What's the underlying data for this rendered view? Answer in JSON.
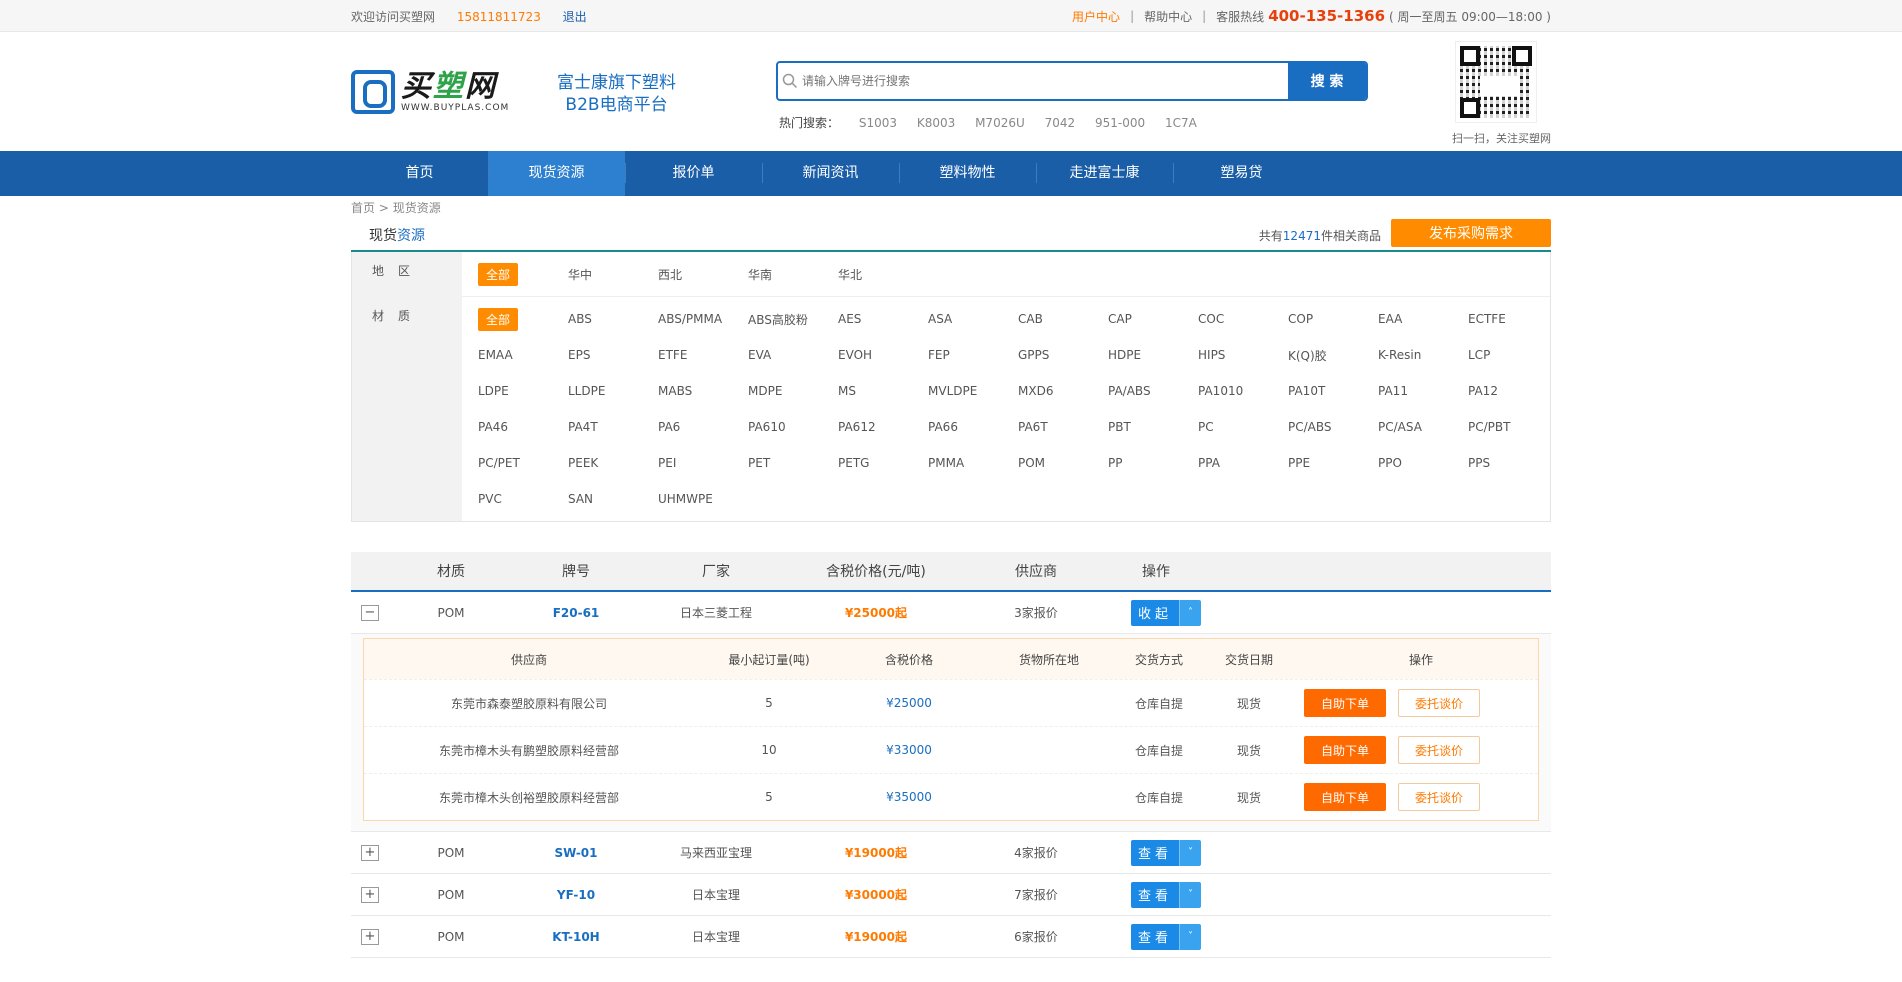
{
  "topbar": {
    "welcome": "欢迎访问买塑网",
    "phone": "15811811723",
    "logout": "退出",
    "user_center": "用户中心",
    "sep": "|",
    "help": "帮助中心",
    "hotline_label": "客服热线",
    "hotline": "400-135-1366",
    "hours": "( 周一至周五 09:00—18:00 )"
  },
  "header": {
    "logo_cn_a": "买",
    "logo_cn_b": "塑",
    "logo_cn_c": "网",
    "logo_en": "WWW.BUYPLAS.COM",
    "slogan_1": "富士康旗下塑料",
    "slogan_2": "B2B电商平台",
    "search_placeholder": "请输入牌号进行搜索",
    "search_button": "搜 索",
    "hot_label": "热门搜索：",
    "hot_words": [
      "S1003",
      "K8003",
      "M7026U",
      "7042",
      "951-000",
      "1C7A"
    ],
    "qr_caption": "扫一扫，关注买塑网"
  },
  "nav": {
    "items": [
      "首页",
      "现货资源",
      "报价单",
      "新闻资讯",
      "塑料物性",
      "走进富士康",
      "塑易贷"
    ]
  },
  "breadcrumb": {
    "home": "首页",
    "sep": ">",
    "current": "现货资源"
  },
  "section": {
    "title_a": "现货",
    "title_b": "资源",
    "count_pre": "共有",
    "count": "12471",
    "count_post": "件相关商品",
    "publish_button": "发布采购需求"
  },
  "filter": {
    "region_label": "地区",
    "regions": [
      "全部",
      "华中",
      "西北",
      "华南",
      "华北"
    ],
    "material_label": "材质",
    "materials": [
      "全部",
      "ABS",
      "ABS/PMMA",
      "ABS高胶粉",
      "AES",
      "ASA",
      "CAB",
      "CAP",
      "COC",
      "COP",
      "EAA",
      "ECTFE",
      "EMAA",
      "EPS",
      "ETFE",
      "EVA",
      "EVOH",
      "FEP",
      "GPPS",
      "HDPE",
      "HIPS",
      "K(Q)胶",
      "K-Resin",
      "LCP",
      "LDPE",
      "LLDPE",
      "MABS",
      "MDPE",
      "MS",
      "MVLDPE",
      "MXD6",
      "PA/ABS",
      "PA1010",
      "PA10T",
      "PA11",
      "PA12",
      "PA46",
      "PA4T",
      "PA6",
      "PA610",
      "PA612",
      "PA66",
      "PA6T",
      "PBT",
      "PC",
      "PC/ABS",
      "PC/ASA",
      "PC/PBT",
      "PC/PET",
      "PEEK",
      "PEI",
      "PET",
      "PETG",
      "PMMA",
      "POM",
      "PP",
      "PPA",
      "PPE",
      "PPO",
      "PPS",
      "PVC",
      "SAN",
      "UHMWPE"
    ]
  },
  "table": {
    "headers": {
      "material": "材质",
      "brand": "牌号",
      "factory": "厂家",
      "price": "含税价格(元/吨)",
      "supplier": "供应商",
      "op": "操作"
    },
    "rows": [
      {
        "expand": "−",
        "material": "POM",
        "brand": "F20-61",
        "factory": "日本三菱工程",
        "price": "¥25000起",
        "supplier": "3家报价",
        "btn": "收起",
        "arrow": "˄"
      },
      {
        "expand": "+",
        "material": "POM",
        "brand": "SW-01",
        "factory": "马来西亚宝理",
        "price": "¥19000起",
        "supplier": "4家报价",
        "btn": "查看",
        "arrow": "˅"
      },
      {
        "expand": "+",
        "material": "POM",
        "brand": "YF-10",
        "factory": "日本宝理",
        "price": "¥30000起",
        "supplier": "7家报价",
        "btn": "查看",
        "arrow": "˅"
      },
      {
        "expand": "+",
        "material": "POM",
        "brand": "KT-10H",
        "factory": "日本宝理",
        "price": "¥19000起",
        "supplier": "6家报价",
        "btn": "查看",
        "arrow": "˅"
      }
    ],
    "sub_headers": {
      "supplier": "供应商",
      "moq": "最小起订量(吨)",
      "price": "含税价格",
      "location": "货物所在地",
      "delivery": "交货方式",
      "date": "交货日期",
      "op": "操作"
    },
    "sub_rows": [
      {
        "supplier": "东莞市森泰塑胶原料有限公司",
        "moq": "5",
        "price": "¥25000",
        "location": "",
        "delivery": "仓库自提",
        "date": "现货",
        "order": "自助下单",
        "negotiate": "委托谈价"
      },
      {
        "supplier": "东莞市樟木头有鹏塑胶原料经营部",
        "moq": "10",
        "price": "¥33000",
        "location": "",
        "delivery": "仓库自提",
        "date": "现货",
        "order": "自助下单",
        "negotiate": "委托谈价"
      },
      {
        "supplier": "东莞市樟木头创裕塑胶原料经营部",
        "moq": "5",
        "price": "¥35000",
        "location": "",
        "delivery": "仓库自提",
        "date": "现货",
        "order": "自助下单",
        "negotiate": "委托谈价"
      }
    ]
  }
}
